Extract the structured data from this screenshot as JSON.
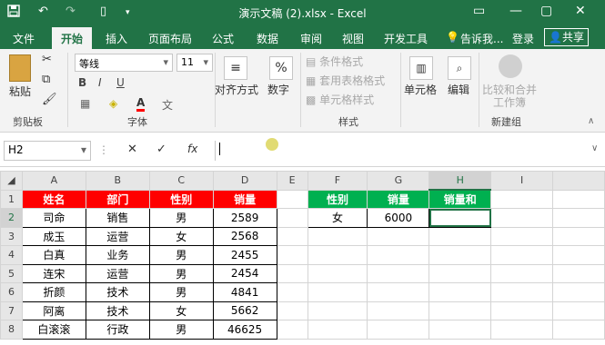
{
  "titlebar": {
    "title": "演示文稿 (2).xlsx - Excel",
    "save_icon": "save-icon",
    "undo_icon": "undo-icon",
    "redo_icon": "redo-icon",
    "color": "#217346"
  },
  "tabs": [
    "文件",
    "开始",
    "插入",
    "页面布局",
    "公式",
    "数据",
    "审阅",
    "视图",
    "开发工具"
  ],
  "tell_me": "告诉我...",
  "login": "登录",
  "share": "共享",
  "ribbon": {
    "paste": "粘贴",
    "clipboard": "剪贴板",
    "font_name": "等线",
    "font_size": "11",
    "font_group": "字体",
    "align": "对齐方式",
    "number": "数字",
    "cond_format": "条件格式",
    "table_format": "套用表格格式",
    "cell_style": "单元格样式",
    "style_group": "样式",
    "cells": "单元格",
    "edit": "编辑",
    "compare_merge_1": "比较和合并",
    "compare_merge_2": "工作簿",
    "new_group": "新建组",
    "bold": "B",
    "italic": "I",
    "underline": "U",
    "font_color": "A",
    "font_color_value": "#ff0000"
  },
  "formula": {
    "namebox": "H2",
    "fx": "fx",
    "cancel": "✕",
    "confirm": "✓",
    "content": ""
  },
  "sheet": {
    "columns": [
      "A",
      "B",
      "C",
      "D",
      "E",
      "F",
      "G",
      "H",
      "I"
    ],
    "rows": [
      "1",
      "2",
      "3",
      "4",
      "5",
      "6",
      "7",
      "8"
    ],
    "headers": [
      "姓名",
      "部门",
      "性别",
      "销量"
    ],
    "data": [
      [
        "司命",
        "销售",
        "男",
        "2589"
      ],
      [
        "成玉",
        "运营",
        "女",
        "2568"
      ],
      [
        "白真",
        "业务",
        "男",
        "2455"
      ],
      [
        "连宋",
        "运营",
        "男",
        "2454"
      ],
      [
        "折颜",
        "技术",
        "男",
        "4841"
      ],
      [
        "阿离",
        "技术",
        "女",
        "5662"
      ],
      [
        "白滚滚",
        "行政",
        "男",
        "46625"
      ]
    ],
    "side_headers": [
      "性别",
      "销量",
      "销量和"
    ],
    "side_values": [
      "女",
      "6000",
      ""
    ],
    "red": "#ff0000",
    "green": "#00b050"
  }
}
